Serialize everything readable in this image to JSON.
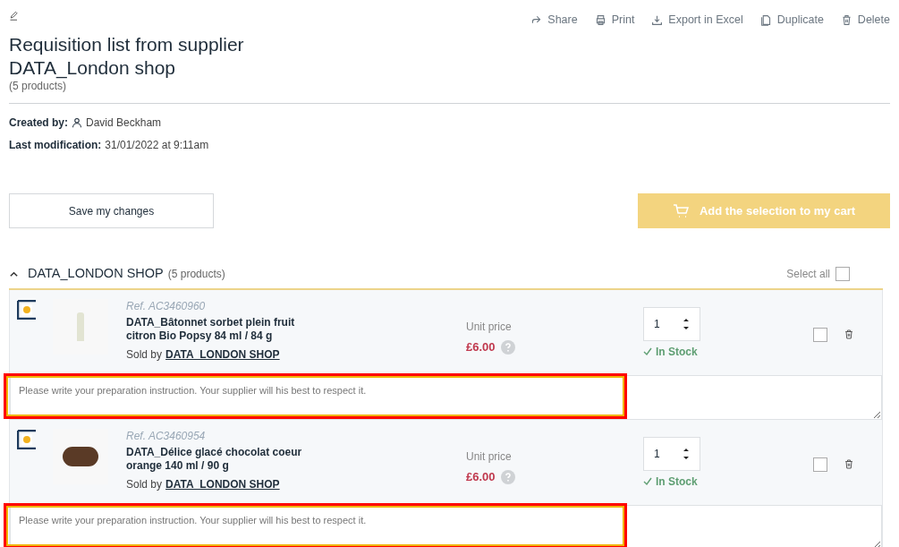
{
  "header": {
    "title": "Requisition list from supplier DATA_London shop",
    "count": "(5 products)"
  },
  "actions": [
    {
      "kind": "share",
      "label": "Share"
    },
    {
      "kind": "print",
      "label": "Print"
    },
    {
      "kind": "export",
      "label": "Export in Excel"
    },
    {
      "kind": "duplicate",
      "label": "Duplicate"
    },
    {
      "kind": "delete",
      "label": "Delete"
    }
  ],
  "meta": [
    {
      "label": "Created by:",
      "value": "David Beckham",
      "kind": "user"
    },
    {
      "label": "Last modification:",
      "value": "31/01/2022 at 9:11am",
      "kind": "text"
    }
  ],
  "save_button": "Save my changes",
  "cart_button": {
    "label": "Add the selection to my cart",
    "disabled": true
  },
  "section": {
    "name": "DATA_LONDON SHOP",
    "count": "(5 products)",
    "expanded": true,
    "select_all": {
      "label": "Select all",
      "checked": false
    }
  },
  "products": [
    {
      "ref": "Ref. AC3460960",
      "name": "DATA_Bâtonnet sorbet plein fruit citron Bio Popsy 84 ml / 84 g",
      "sold_by": "Sold by",
      "seller": "DATA_LONDON SHOP",
      "price_label": "Unit price",
      "price": "£6.00",
      "quantity": "1",
      "stock": "In Stock",
      "checked": false,
      "instruction_placeholder": "Please write your preparation instruction. Your supplier will his best to respect it.",
      "highlighted": true
    },
    {
      "ref": "Ref. AC3460954",
      "name": "DATA_Délice glacé chocolat coeur orange 140 ml / 90 g",
      "sold_by": "Sold by",
      "seller": "DATA_LONDON SHOP",
      "price_label": "Unit price",
      "price": "£6.00",
      "quantity": "1",
      "stock": "In Stock",
      "checked": false,
      "instruction_placeholder": "Please write your preparation instruction. Your supplier will his best to respect it.",
      "highlighted": true
    }
  ]
}
